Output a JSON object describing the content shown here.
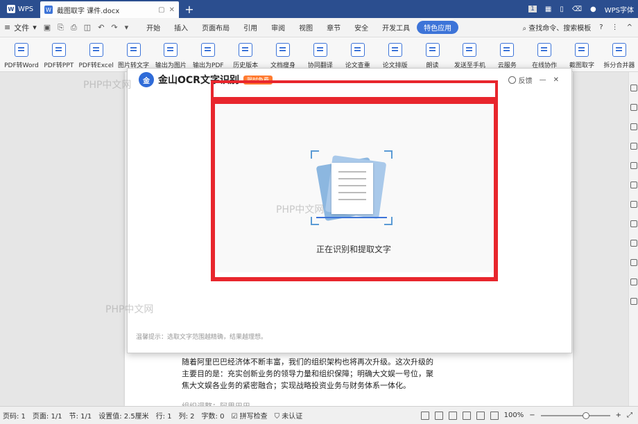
{
  "titlebar": {
    "app": "WPS",
    "doc_tab": "截图取字 课件.docx",
    "badge": "1",
    "account": "WPS字体"
  },
  "menubar": {
    "file": "文件",
    "items": [
      "开始",
      "插入",
      "页面布局",
      "引用",
      "审阅",
      "视图",
      "章节",
      "安全",
      "开发工具"
    ],
    "special": "特色应用",
    "search": "查找命令、搜索模板"
  },
  "ribbon": {
    "buttons": [
      "PDF转Word",
      "PDF转PPT",
      "PDF转Excel",
      "图片转文字",
      "输出为图片",
      "输出为PDF",
      "历史版本",
      "文档瘦身",
      "协同翻译",
      "论文查重",
      "论文排版",
      "朗读",
      "发送至手机",
      "云服务",
      "在线协作",
      "截图取字",
      "拆分合并器"
    ]
  },
  "ocr": {
    "logo": "金",
    "title": "金山OCR文字识别",
    "badge": "限时免费",
    "feedback": "反馈",
    "status": "正在识别和提取文字",
    "hint": "温馨提示：选取文字范围越精确，结果越理想。"
  },
  "watermark": "PHP中文网",
  "doc": {
    "lines": [
      "随着阿里巴巴经济体不断丰富，我们的组织架构也将再次升级。这次升级的",
      "主要目的是：充实创新业务的领导力量和组织保障；明确大文娱一号位，聚",
      "焦大文娱各业务的紧密融合；实现战略投资业务与财务体系一体化。"
    ],
    "next_line": "组织调整：阿里巴巴..."
  },
  "statusbar": {
    "page": "页码: 1",
    "pages": "页面: 1/1",
    "section": "节: 1/1",
    "setting": "设置值: 2.5厘米",
    "row": "行: 1",
    "col": "列: 2",
    "words": "字数: 0",
    "spell": "拼写检查",
    "cert": "未认证",
    "zoom": "100%"
  }
}
